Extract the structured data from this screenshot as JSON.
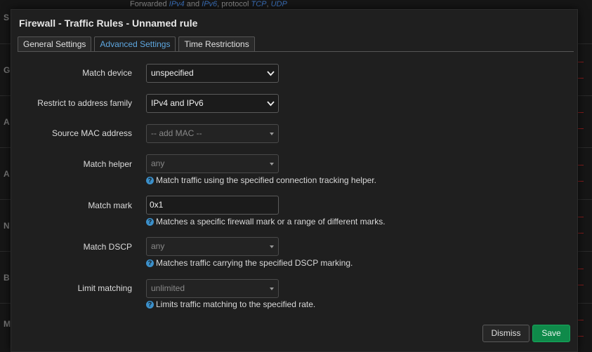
{
  "background": {
    "topline_prefix": "Forwarded",
    "topline_ipv4": "IPv4",
    "topline_and": "and",
    "topline_ipv6": "IPv6",
    "topline_protocol": ", protocol",
    "topline_tcp": "TCP",
    "topline_udp": "UDP",
    "letters": [
      "S",
      "G",
      "A",
      "A",
      "N",
      "B",
      "M"
    ]
  },
  "modal": {
    "title": "Firewall - Traffic Rules - Unnamed rule",
    "tabs": [
      {
        "label": "General Settings",
        "active": false
      },
      {
        "label": "Advanced Settings",
        "active": true
      },
      {
        "label": "Time Restrictions",
        "active": false
      }
    ],
    "fields": {
      "match_device": {
        "label": "Match device",
        "value": "unspecified"
      },
      "address_family": {
        "label": "Restrict to address family",
        "value": "IPv4 and IPv6"
      },
      "source_mac": {
        "label": "Source MAC address",
        "placeholder": "-- add MAC --"
      },
      "match_helper": {
        "label": "Match helper",
        "value": "any",
        "help": "Match traffic using the specified connection tracking helper."
      },
      "match_mark": {
        "label": "Match mark",
        "value": "0x1",
        "help": "Matches a specific firewall mark or a range of different marks."
      },
      "match_dscp": {
        "label": "Match DSCP",
        "value": "any",
        "help": "Matches traffic carrying the specified DSCP marking."
      },
      "limit_matching": {
        "label": "Limit matching",
        "value": "unlimited",
        "help": "Limits traffic matching to the specified rate."
      }
    },
    "buttons": {
      "dismiss": "Dismiss",
      "save": "Save"
    }
  },
  "colors": {
    "accent_tab": "#5ea7e0",
    "save": "#0f8a4a",
    "help_icon": "#3b8fc9"
  }
}
